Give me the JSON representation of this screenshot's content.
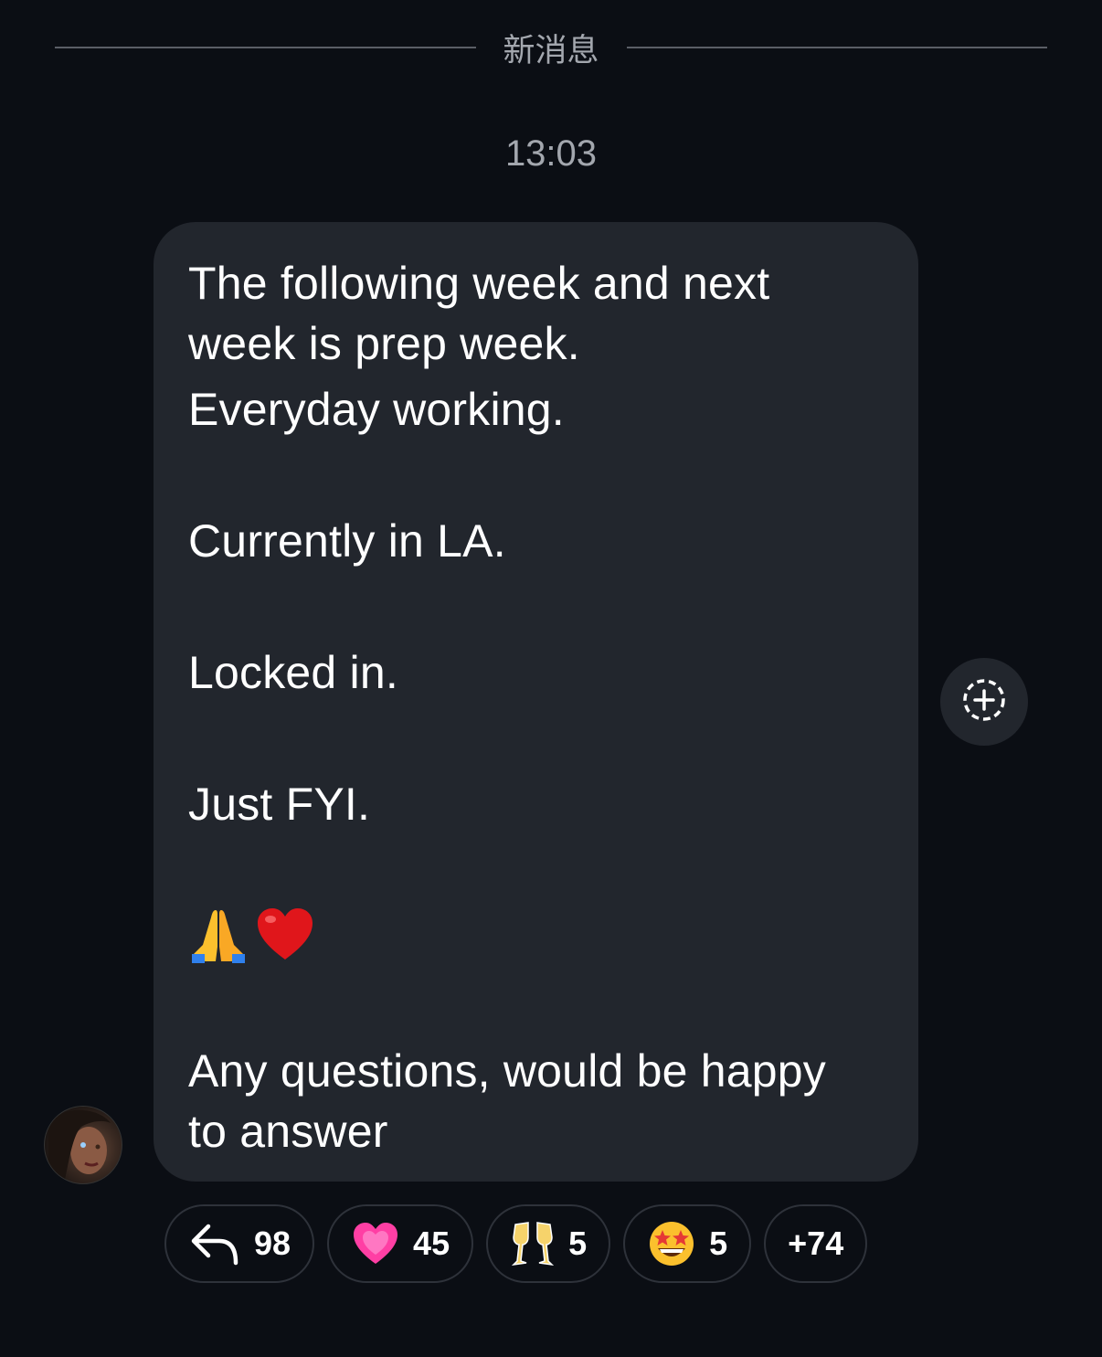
{
  "divider": {
    "label": "新消息"
  },
  "timestamp": "13:03",
  "message": {
    "lines": [
      "The following week and next",
      "week is prep week.",
      "Everyday working.",
      "Currently in LA.",
      "Locked in.",
      "Just FYI.",
      "Any questions, would be happy",
      "to answer"
    ],
    "emojis": [
      "folded-hands",
      "red-heart"
    ]
  },
  "reactions": [
    {
      "icon": "reply-arrow-icon",
      "count": "98"
    },
    {
      "icon": "growing-heart-emoji",
      "count": "45"
    },
    {
      "icon": "clinking-glasses-emoji",
      "count": "5"
    },
    {
      "icon": "star-struck-emoji",
      "count": "5"
    },
    {
      "icon": "",
      "count": "+74"
    }
  ],
  "colors": {
    "background": "#0b0e14",
    "bubble": "#22262d",
    "muted_text": "#a3a7ae"
  }
}
